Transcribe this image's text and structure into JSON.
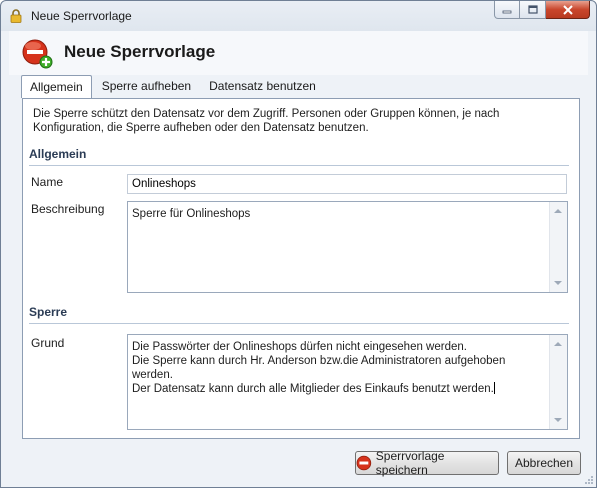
{
  "window": {
    "title": "Neue Sperrvorlage",
    "controls": [
      "minimize",
      "maximize",
      "close"
    ]
  },
  "header": {
    "title": "Neue Sperrvorlage"
  },
  "tabs": [
    {
      "label": "Allgemein",
      "active": true
    },
    {
      "label": "Sperre aufheben",
      "active": false
    },
    {
      "label": "Datensatz benutzen",
      "active": false
    }
  ],
  "panel": {
    "description": "Die Sperre schützt den Datensatz vor dem Zugriff. Personen oder Gruppen können, je nach Konfiguration, die Sperre aufheben oder den Datensatz benutzen.",
    "section_general": "Allgemein",
    "name_label": "Name",
    "name_value": "Onlineshops",
    "description_label": "Beschreibung",
    "description_value": "Sperre für Onlineshops",
    "section_lock": "Sperre",
    "reason_label": "Grund",
    "reason_value": "Die Passwörter der Onlineshops dürfen nicht eingesehen werden.\nDie Sperre kann durch Hr. Anderson bzw.die Administratoren aufgehoben werden.\nDer Datensatz kann durch alle Mitglieder des Einkaufs benutzt werden."
  },
  "footer": {
    "save_label": "Sperrvorlage speichern",
    "cancel_label": "Abbrechen"
  },
  "icons": {
    "title": "lock-icon",
    "header": "lock-add-icon",
    "save": "lock-remove-icon"
  },
  "colors": {
    "accent": "#2b3c55",
    "icon_red": "#d6331c",
    "icon_green": "#3fae2a"
  }
}
